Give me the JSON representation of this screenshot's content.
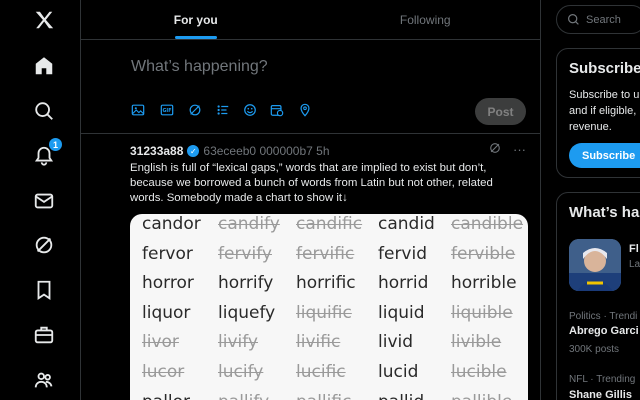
{
  "nav": {
    "notifications_badge": "1"
  },
  "tabs": [
    {
      "label": "For you"
    },
    {
      "label": "Following"
    }
  ],
  "compose": {
    "placeholder": "What’s happening?",
    "post_label": "Post"
  },
  "tweet": {
    "user": "31233a88",
    "handle_meta": "63eceeb0 000000b7 5h",
    "text": "English is full of “lexical gaps,” words that are implied to exist but don’t, because we borrowed a bunch of words from Latin but not other, related words. Somebody made a chart to show it↓",
    "more": "···",
    "rows": [
      [
        {
          "w": "candor",
          "gap": false
        },
        {
          "w": "candify",
          "gap": true
        },
        {
          "w": "candific",
          "gap": true
        },
        {
          "w": "candid",
          "gap": false
        },
        {
          "w": "candible",
          "gap": true
        }
      ],
      [
        {
          "w": "fervor",
          "gap": false
        },
        {
          "w": "fervify",
          "gap": true
        },
        {
          "w": "fervific",
          "gap": true
        },
        {
          "w": "fervid",
          "gap": false
        },
        {
          "w": "fervible",
          "gap": true
        }
      ],
      [
        {
          "w": "horror",
          "gap": false
        },
        {
          "w": "horrify",
          "gap": false
        },
        {
          "w": "horrific",
          "gap": false
        },
        {
          "w": "horrid",
          "gap": false
        },
        {
          "w": "horrible",
          "gap": false
        }
      ],
      [
        {
          "w": "liquor",
          "gap": false
        },
        {
          "w": "liquefy",
          "gap": false
        },
        {
          "w": "liquific",
          "gap": true
        },
        {
          "w": "liquid",
          "gap": false
        },
        {
          "w": "liquible",
          "gap": true
        }
      ],
      [
        {
          "w": "livor",
          "gap": true
        },
        {
          "w": "livify",
          "gap": true
        },
        {
          "w": "livific",
          "gap": true
        },
        {
          "w": "livid",
          "gap": false
        },
        {
          "w": "livible",
          "gap": true
        }
      ],
      [
        {
          "w": "lucor",
          "gap": true
        },
        {
          "w": "lucify",
          "gap": true
        },
        {
          "w": "lucific",
          "gap": true
        },
        {
          "w": "lucid",
          "gap": false
        },
        {
          "w": "lucible",
          "gap": true
        }
      ],
      [
        {
          "w": "pallor",
          "gap": false
        },
        {
          "w": "pallify",
          "gap": true
        },
        {
          "w": "pallific",
          "gap": true
        },
        {
          "w": "pallid",
          "gap": false
        },
        {
          "w": "pallible",
          "gap": true
        }
      ]
    ]
  },
  "right": {
    "search_placeholder": "Search",
    "subscribe": {
      "title": "Subscribe",
      "line1": "Subscribe to u",
      "line2": "and if eligible,",
      "line3": "revenue.",
      "button": "Subscribe"
    },
    "whats": {
      "title": "What’s ha",
      "card_initial": "Fl",
      "card_sub": "La"
    },
    "trends": [
      {
        "label": "Politics · Trendi",
        "name": "Abrego Garci",
        "count": "300K posts"
      },
      {
        "label": "NFL · Trending",
        "name": "Shane Gillis"
      }
    ]
  },
  "colors": {
    "accent": "#1d9bf0",
    "border": "#2f3336",
    "muted": "#71767b"
  }
}
